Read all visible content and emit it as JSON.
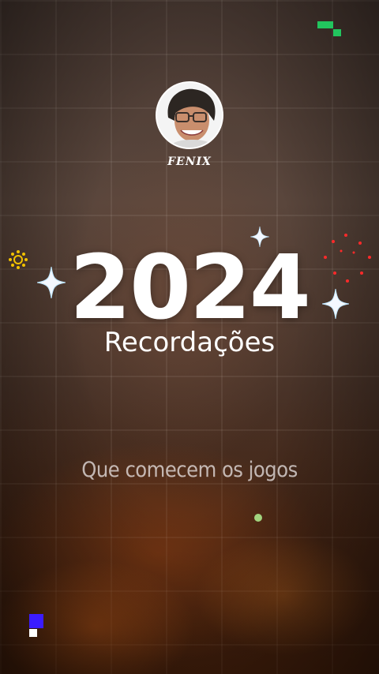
{
  "profile": {
    "username": "FENIX"
  },
  "title": {
    "year": "2024",
    "subtitle": "Recordações"
  },
  "tagline": "Que comecem os jogos",
  "decor": {
    "sparkle_color": "#f4f8ff",
    "sparkle_glow": "#bfe6ff",
    "accent_green": "#22c55e",
    "accent_blue": "#3b1cff",
    "accent_yellow": "#f2c200",
    "accent_red": "#ff2a2a"
  }
}
